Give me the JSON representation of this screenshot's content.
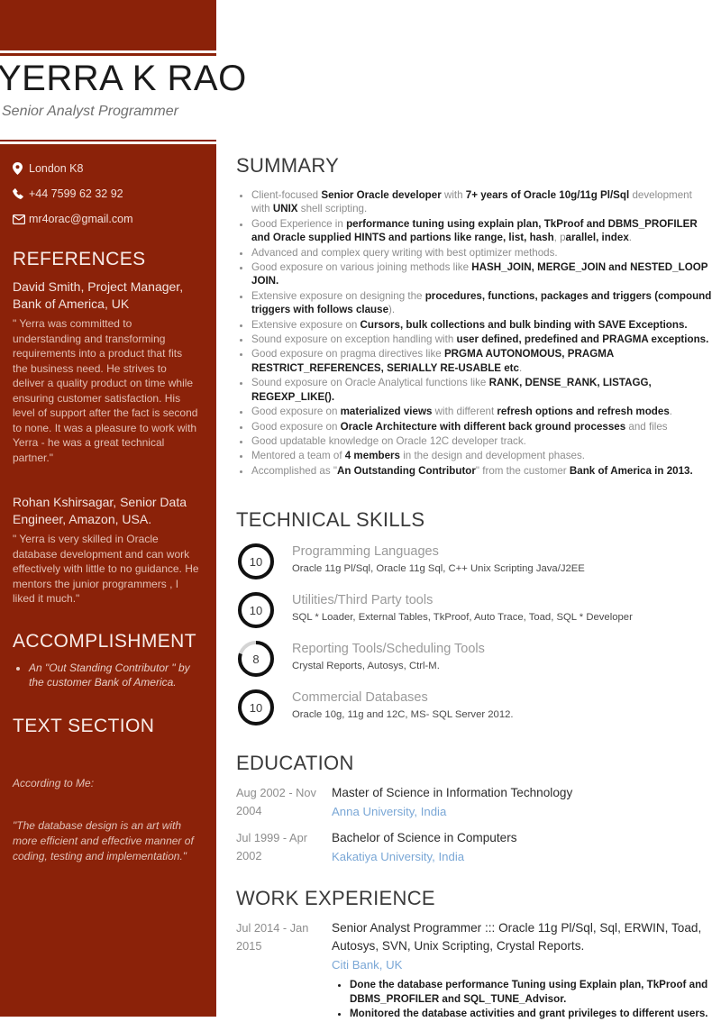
{
  "sidebar": {
    "contact": [
      {
        "icon": "location-pin-icon",
        "text": "London K8"
      },
      {
        "icon": "phone-icon",
        "text": "+44 7599 62 32 92"
      },
      {
        "icon": "envelope-icon",
        "text": "mr4orac@gmail.com"
      }
    ],
    "references": {
      "heading": "REFERENCES",
      "items": [
        {
          "name": "David Smith, Project Manager, Bank of America, UK",
          "quote": "\" Yerra was committed to understanding and transforming requirements into a product that fits the business need. He strives to deliver a quality product on time while ensuring customer satisfaction. His level of support after the fact is second to none. It was a pleasure to work with Yerra - he was a great technical partner.\""
        },
        {
          "name": "Rohan Kshirsagar, Senior Data Engineer, Amazon, USA.",
          "quote": "\" Yerra is very skilled in Oracle database development and can work effectively with little to no guidance. He mentors the junior programmers , I liked it much.\""
        }
      ]
    },
    "accomplishment": {
      "heading": "ACCOMPLISHMENT",
      "items": [
        "An \"Out Standing Contributor \"  by the customer Bank of America."
      ]
    },
    "text_section": {
      "heading": "TEXT SECTION",
      "lead": "According to Me:",
      "quote": "\"The database design is an art with more efficient and effective manner of coding, testing and implementation.\""
    }
  },
  "header": {
    "name": "YERRA K RAO",
    "title": "Senior Analyst Programmer"
  },
  "main": {
    "summary": {
      "heading": "SUMMARY",
      "bullets": [
        "Client-focused <b>Senior Oracle developer</b> with <b>7+ years of Oracle  10g/11g Pl/Sql</b> development with <b>UNIX</b> shell scripting.",
        "Good Experience in <b>performance tuning using explain plan, TkProof and DBMS_PROFILER and Oracle supplied HINTS and partions like range, list, hash</b>, p<b>arallel, index</b>.",
        "Advanced and complex query writing with best optimizer methods.",
        "Good exposure on various joining methods like <b>HASH_JOIN, MERGE_JOIN and NESTED_LOOP JOIN.</b>",
        "Extensive exposure on designing the <b>procedures, functions, packages and triggers (compound triggers with follows clause</b>).",
        "Extensive exposure on <b>Cursors, bulk collections and bulk binding with SAVE Exceptions.</b>",
        "Sound exposure on exception handling with <b>user defined, predefined and PRAGMA exceptions.</b>",
        "Good exposure on pragma directives like <b>PRGMA AUTONOMOUS, PRAGMA RESTRICT_REFERENCES, SERIALLY RE-USABLE etc</b>.",
        "Sound exposure on Oracle Analytical functions like <b>RANK, DENSE_RANK, LISTAGG, REGEXP_LIKE().</b>",
        "Good exposure on <b>materialized views</b> with different <b>refresh options and refresh modes</b>.",
        "Good exposure on <b>Oracle Architecture with different back ground processes</b> and files",
        "Good updatable knowledge on Oracle 12C developer track.",
        "Mentored a team of <b>4 members</b> in the design and development phases.",
        "Accomplished as \"<b>An Outstanding Contributor</b>\" from the customer <b>Bank of America in 2013.</b>"
      ]
    },
    "technical_skills": {
      "heading": "TECHNICAL SKILLS",
      "items": [
        {
          "value": "10",
          "percent": 100,
          "name": "Programming Languages",
          "detail": "Oracle 11g Pl/Sql, Oracle 11g Sql, C++ Unix Scripting Java/J2EE"
        },
        {
          "value": "10",
          "percent": 100,
          "name": "Utilities/Third Party tools",
          "detail": "SQL * Loader, External Tables, TkProof, Auto Trace, Toad, SQL * Developer"
        },
        {
          "value": "8",
          "percent": 80,
          "name": "Reporting Tools/Scheduling Tools",
          "detail": "Crystal Reports, Autosys, Ctrl-M."
        },
        {
          "value": "10",
          "percent": 100,
          "name": "Commercial Databases",
          "detail": "Oracle 10g, 11g and 12C, MS- SQL Server 2012."
        }
      ]
    },
    "education": {
      "heading": "EDUCATION",
      "items": [
        {
          "date": "Aug 2002 - Nov 2004",
          "title": "Master of Science in Information Technology",
          "org": "Anna University, India"
        },
        {
          "date": "Jul 1999 - Apr 2002",
          "title": "Bachelor of Science in Computers",
          "org": "Kakatiya University, India"
        }
      ]
    },
    "work_experience": {
      "heading": "WORK EXPERIENCE",
      "items": [
        {
          "date": "Jul 2014 - Jan 2015",
          "title": "Senior Analyst Programmer ::: Oracle 11g Pl/Sql, Sql, ERWIN, Toad, Autosys, SVN, Unix Scripting, Crystal Reports.",
          "org": "Citi Bank, UK",
          "bullets": [
            "Done the database performance Tuning using Explain plan, TkProof and DBMS_PROFILER and SQL_TUNE_Advisor.",
            "Monitored the database activities and grant privileges to different users."
          ]
        }
      ]
    }
  },
  "colors": {
    "accent_red": "#8b2209",
    "link_blue": "#7aa7d6",
    "body_gray": "#8d8d8d",
    "heading_dark": "#3a3a3a"
  }
}
